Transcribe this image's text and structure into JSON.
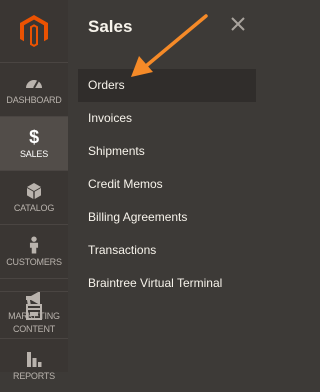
{
  "sidebar": {
    "logo_icon": "magento-logo",
    "items": [
      {
        "label": "Dashboard",
        "icon": "speedometer-icon"
      },
      {
        "label": "Sales",
        "icon": "dollar-icon"
      },
      {
        "label": "Catalog",
        "icon": "box-icon"
      },
      {
        "label": "Customers",
        "icon": "person-icon"
      },
      {
        "label": "Marketing",
        "icon": "megaphone-icon"
      },
      {
        "label": "Content",
        "icon": "layout-icon"
      },
      {
        "label": "Reports",
        "icon": "bar-chart-icon"
      }
    ],
    "active_item": "Sales"
  },
  "panel": {
    "title": "Sales",
    "close_icon": "close-icon",
    "menu": [
      {
        "label": "Orders"
      },
      {
        "label": "Invoices"
      },
      {
        "label": "Shipments"
      },
      {
        "label": "Credit Memos"
      },
      {
        "label": "Billing Agreements"
      },
      {
        "label": "Transactions"
      },
      {
        "label": "Braintree Virtual Terminal"
      }
    ],
    "highlighted_item": "Orders"
  },
  "annotation": {
    "icon": "arrow-icon",
    "color": "#f58a28"
  },
  "colors": {
    "brand": "#eb5202",
    "sidebar_bg": "#3a3633",
    "panel_bg": "#3d3a37",
    "text": "#f7f3eb"
  }
}
